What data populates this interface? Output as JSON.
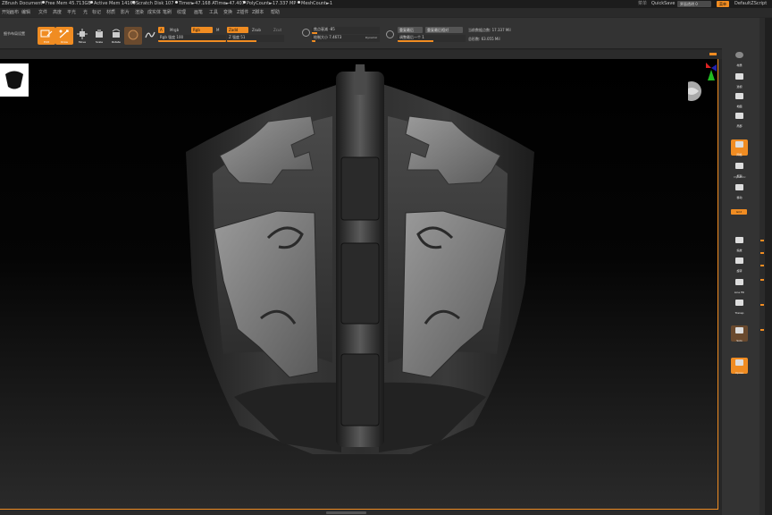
{
  "status_bar": {
    "document": "ZBrush Document",
    "free_mem": "Free Mem 45.713GB",
    "active_mem": "Active Mem 14169",
    "scratch_disk": "Scratch Disk 107",
    "timer": "Timer►47.168 ATime►47.407",
    "poly_count": "PolyCount►17.337 MP",
    "mesh_count": "MeshCount►1",
    "menu_left": "菜单",
    "quicksave": "QuickSave",
    "transparency": "界面透明 0",
    "menu_right": "菜单",
    "script": "DefaultZScript"
  },
  "menu_bar": {
    "items": [
      "开始",
      "画布",
      "编辑",
      "文件",
      "高度",
      "平光",
      "光",
      "标记",
      "材质",
      "影片",
      "渲染",
      "成实体",
      "笔刷",
      "纹理",
      "画笔",
      "工具",
      "变换",
      "Z插件",
      "Z脚本",
      "帮助"
    ]
  },
  "toolbar": {
    "left_label": "细节布局设置",
    "tools": [
      {
        "label": "Edit",
        "icon": "edit-icon",
        "active": true
      },
      {
        "label": "Draw",
        "icon": "draw-icon",
        "active": true
      },
      {
        "label": "Move",
        "icon": "move-icon",
        "active": false
      },
      {
        "label": "Scale",
        "icon": "scale-icon",
        "active": false
      },
      {
        "label": "Rotate",
        "icon": "rotate-icon",
        "active": false
      }
    ],
    "mrgb": "A",
    "rgb_label": "Mrgb",
    "rgb_active": "Rgb",
    "m_label": "M",
    "zadd": "Zadd",
    "zsub": "Zsub",
    "zcut": "Zcut",
    "rgb_intensity": "Rgb 强度 100",
    "z_intensity": "Z 强度 51",
    "focal_shift": "焦点衰减 -85",
    "draw_size": "绘制大小 7.4673",
    "dynamic": "Dynamic",
    "replay_last": "重复最后",
    "replay_last_rel": "重复最后相对",
    "adjust_last": "调整最后一个 1",
    "active_points": "当前数据点数: 17.337 Mil",
    "total_points": "总形数: 63.055 Mil"
  },
  "right_shelf": {
    "buttons": [
      {
        "label": "材质",
        "icon": "sphere-icon"
      },
      {
        "label": "透视",
        "icon": "persp-icon"
      },
      {
        "label": "地面",
        "icon": "floor-icon"
      },
      {
        "label": "局部",
        "icon": "local-icon"
      },
      {
        "label": "网格",
        "icon": "grid-icon"
      },
      {
        "label": "框架",
        "icon": "frame-icon"
      },
      {
        "label": "移动",
        "icon": "move-icon"
      },
      {
        "label": "缩放",
        "icon": "zoom-icon"
      },
      {
        "label": "旋转",
        "icon": "rotate-icon"
      },
      {
        "label": "Line Fill",
        "icon": "linefill-icon"
      },
      {
        "label": "Transp",
        "icon": "transp-icon"
      },
      {
        "label": "Solo",
        "icon": "solo-icon"
      },
      {
        "label": "Xpose",
        "icon": "xpose-icon"
      }
    ],
    "dynamic_label": "Dynamic",
    "chip": "Grid"
  },
  "viewport": {
    "mesh": "mask-sculpt",
    "accent": "#f08c22"
  }
}
